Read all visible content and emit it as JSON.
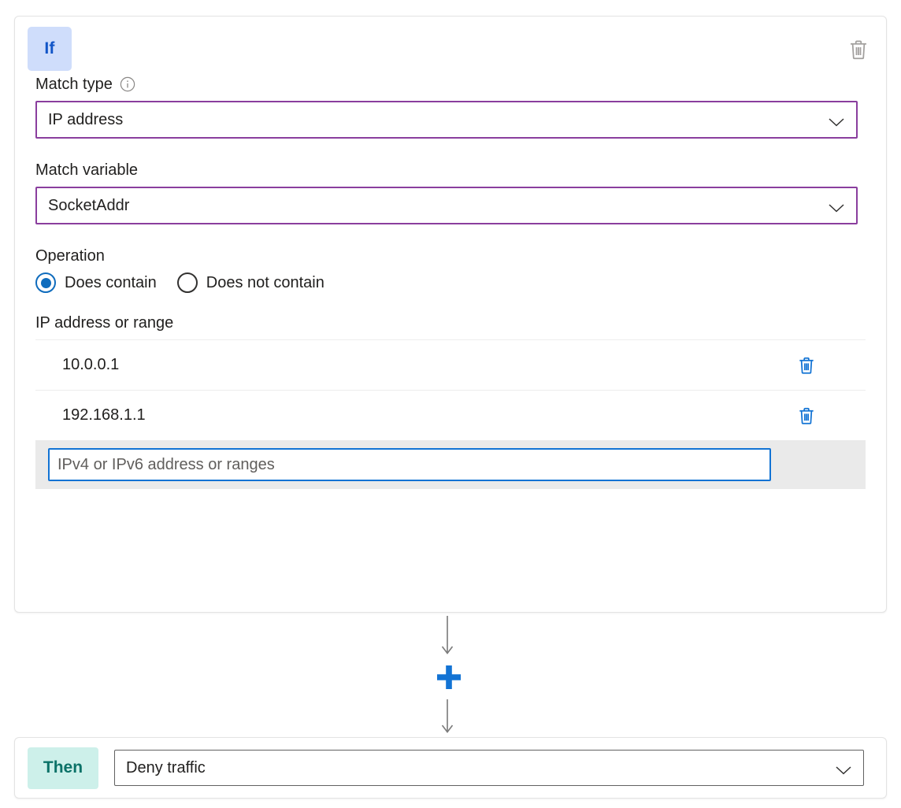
{
  "rule": {
    "if_card": {
      "badge_label": "If",
      "delete_icon": "trash-icon",
      "match_type": {
        "label": "Match type",
        "info_icon": "info-icon",
        "value": "IP address",
        "chevron_icon": "chevron-down-icon"
      },
      "match_variable": {
        "label": "Match variable",
        "value": "SocketAddr",
        "chevron_icon": "chevron-down-icon"
      },
      "operation": {
        "label": "Operation",
        "options": [
          {
            "label": "Does contain",
            "selected": true
          },
          {
            "label": "Does not contain",
            "selected": false
          }
        ]
      },
      "ip_section": {
        "label": "IP address or range",
        "entries": [
          {
            "value": "10.0.0.1",
            "delete_icon": "trash-icon"
          },
          {
            "value": "192.168.1.1",
            "delete_icon": "trash-icon"
          }
        ],
        "new_entry": {
          "value": "",
          "placeholder": "IPv4 or IPv6 address or ranges"
        }
      }
    },
    "connector": {
      "add_icon": "plus-icon",
      "arrow_icon": "arrow-down-icon"
    },
    "then_card": {
      "badge_label": "Then",
      "action": {
        "value": "Deny traffic",
        "chevron_icon": "chevron-down-icon"
      }
    }
  },
  "colors": {
    "if_badge_bg": "#cfddfb",
    "if_badge_text": "#1155c7",
    "then_badge_bg": "#cdf0ea",
    "then_badge_text": "#0b7268",
    "select_border_purple": "#8a3e9e",
    "accent_blue": "#0f6cbd",
    "delete_blue": "#1273d4",
    "row_input_bg": "#eaeaea"
  }
}
